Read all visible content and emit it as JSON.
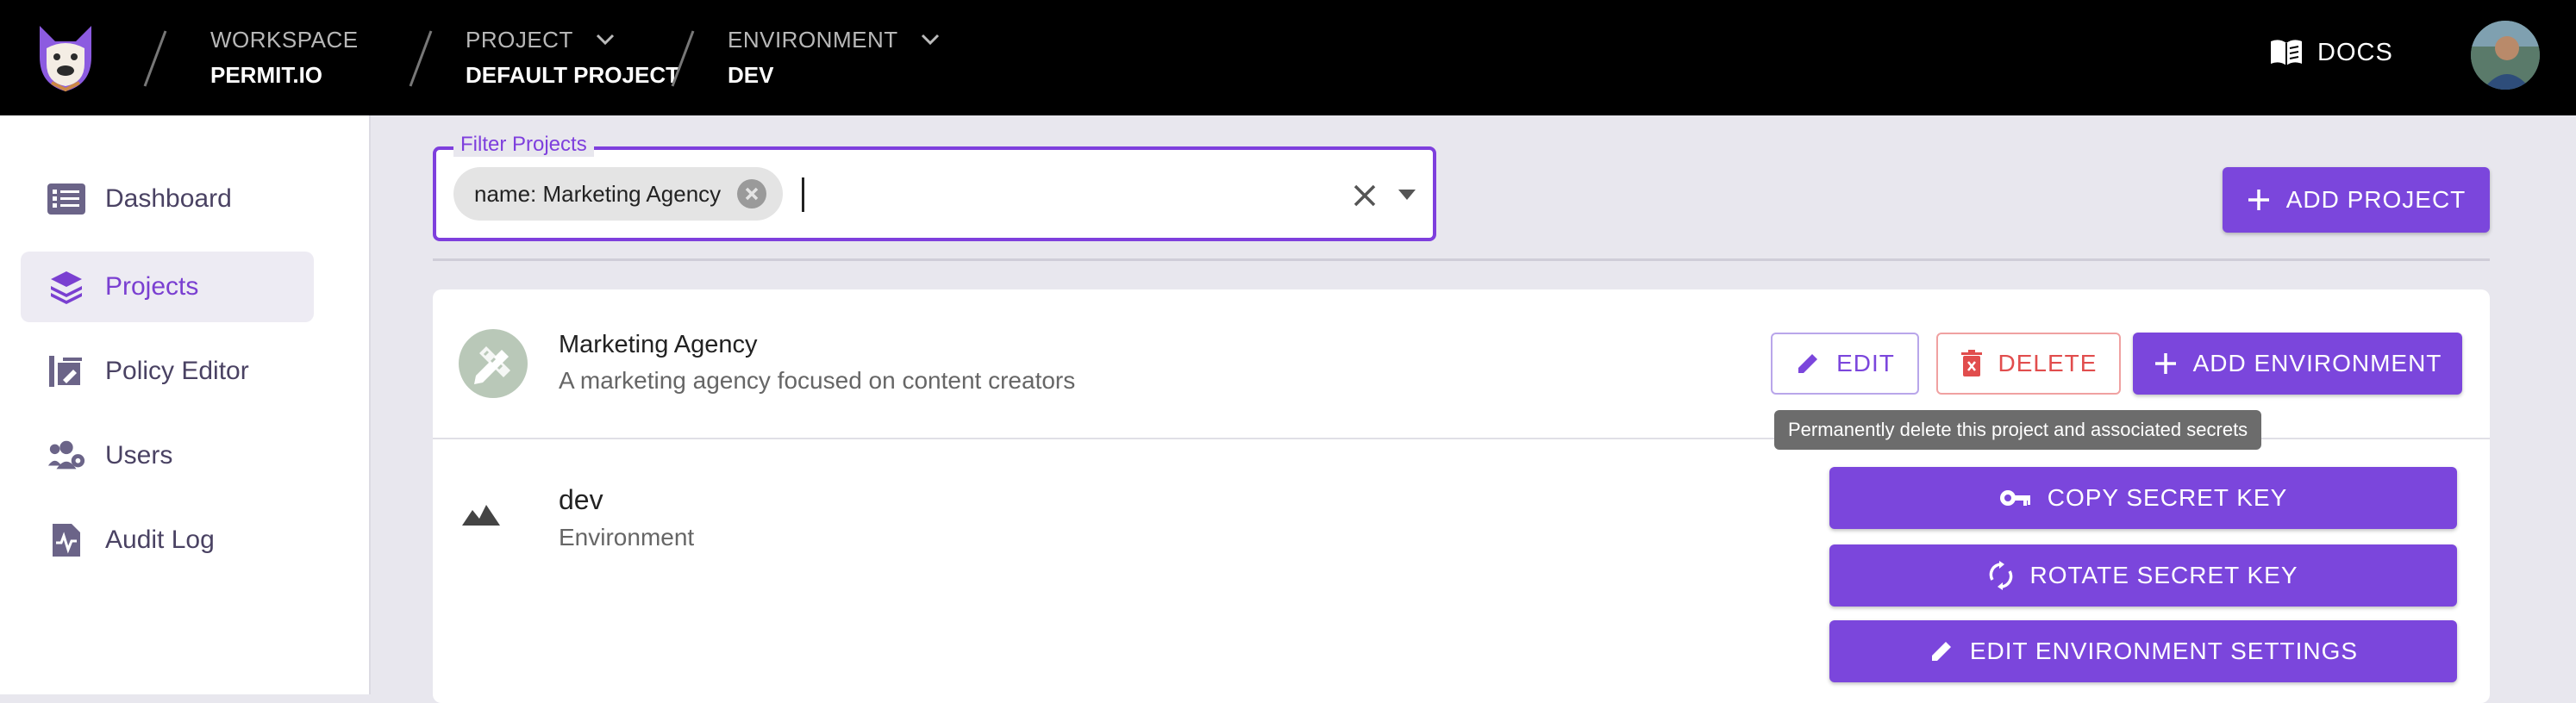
{
  "topbar": {
    "breadcrumbs": [
      {
        "label": "WORKSPACE",
        "value": "PERMIT.IO"
      },
      {
        "label": "PROJECT",
        "value": "DEFAULT PROJECT"
      },
      {
        "label": "ENVIRONMENT",
        "value": "DEV"
      }
    ],
    "docs_label": "DOCS",
    "logo_icon": "dog-logo-icon",
    "book_icon": "book-open-icon"
  },
  "sidebar": {
    "items": [
      {
        "label": "Dashboard",
        "icon": "list-icon",
        "active": false
      },
      {
        "label": "Projects",
        "icon": "layers-icon",
        "active": true
      },
      {
        "label": "Policy Editor",
        "icon": "policy-editor-icon",
        "active": false
      },
      {
        "label": "Users",
        "icon": "users-icon",
        "active": false
      },
      {
        "label": "Audit Log",
        "icon": "audit-log-icon",
        "active": false
      }
    ]
  },
  "filter": {
    "legend": "Filter Projects",
    "chip": "name: Marketing Agency"
  },
  "toolbar": {
    "add_project_label": "ADD PROJECT"
  },
  "project": {
    "name": "Marketing Agency",
    "description": "A marketing agency focused on content creators",
    "edit_label": "EDIT",
    "delete_label": "DELETE",
    "add_environment_label": "ADD ENVIRONMENT",
    "tooltip": "Permanently delete this project and associated secrets"
  },
  "environment": {
    "name": "dev",
    "subtitle": "Environment",
    "copy_label": "COPY SECRET KEY",
    "rotate_label": "ROTATE SECRET KEY",
    "edit_settings_label": "EDIT ENVIRONMENT SETTINGS"
  },
  "colors": {
    "accent": "#7b46dc",
    "danger": "#e14d4d",
    "topbar": "#000000"
  }
}
